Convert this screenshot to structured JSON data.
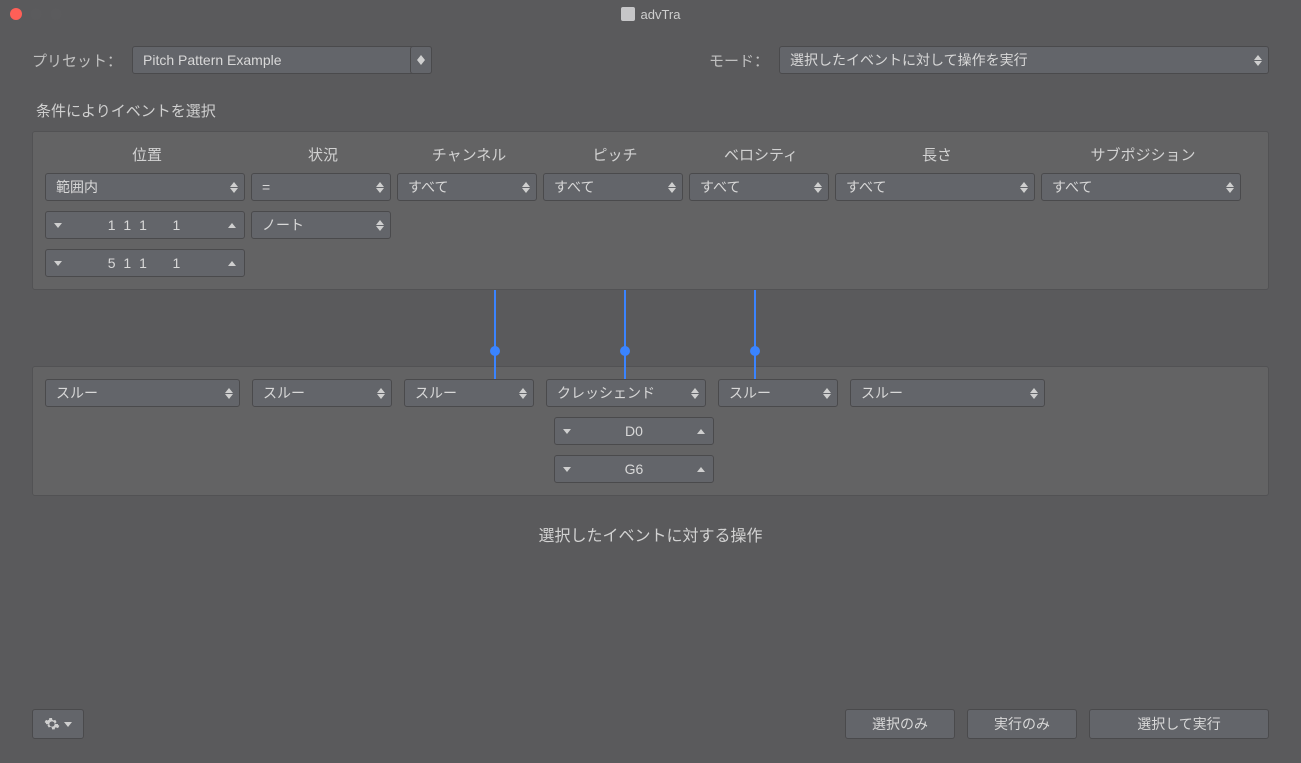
{
  "window": {
    "title": "advTra"
  },
  "top": {
    "preset_label": "プリセット：",
    "preset_value": "Pitch Pattern Example",
    "mode_label": "モード：",
    "mode_value": "選択したイベントに対して操作を実行"
  },
  "conditions": {
    "section_title": "条件によりイベントを選択",
    "headers": {
      "position": "位置",
      "status": "状況",
      "channel": "チャンネル",
      "pitch": "ピッチ",
      "velocity": "ベロシティ",
      "length": "長さ",
      "subposition": "サブポジション"
    },
    "row": {
      "position_mode": "範囲内",
      "status_op": "=",
      "channel": "すべて",
      "pitch": "すべて",
      "velocity": "すべて",
      "length": "すべて",
      "subposition": "すべて"
    },
    "position_from": "1 1 1    1",
    "status_type": "ノート",
    "position_to": "5 1 1    1"
  },
  "operations": {
    "row": {
      "c1": "スルー",
      "c2": "スルー",
      "c3": "スルー",
      "c4": "クレッシェンド",
      "c5": "スルー",
      "c6": "スルー"
    },
    "pitch_from": "D0",
    "pitch_to": "G6",
    "caption": "選択したイベントに対する操作"
  },
  "footer": {
    "select_only": "選択のみ",
    "execute_only": "実行のみ",
    "select_and_execute": "選択して実行"
  }
}
